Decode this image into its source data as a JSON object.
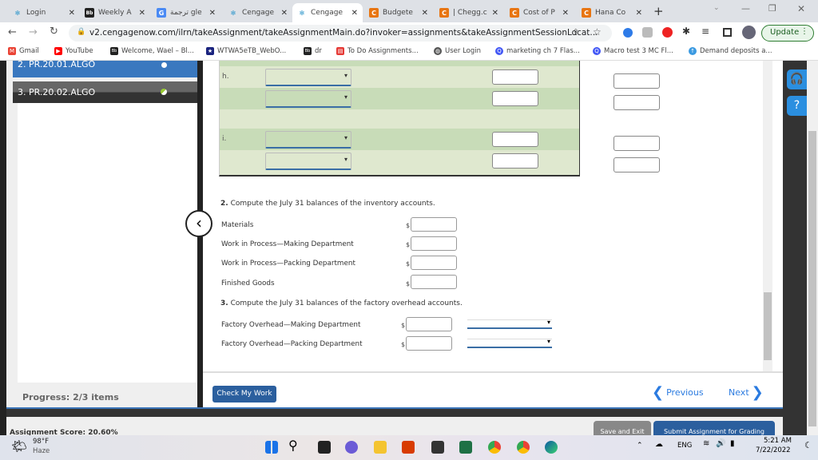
{
  "browser": {
    "tabs": [
      {
        "label": "Login",
        "icon": "cengage-spinner-icon"
      },
      {
        "label": "Weekly A",
        "icon": "blackboard-icon"
      },
      {
        "label": "ترجمة gle",
        "icon": "google-translate-icon"
      },
      {
        "label": "Cengage",
        "icon": "cengage-spinner-icon"
      },
      {
        "label": "Cengage",
        "icon": "cengage-spinner-icon",
        "active": true
      },
      {
        "label": "Budgete",
        "icon": "chegg-icon"
      },
      {
        "label": "| Chegg.c",
        "icon": "chegg-icon"
      },
      {
        "label": "Cost of P",
        "icon": "chegg-icon"
      },
      {
        "label": "Hana Co",
        "icon": "chegg-icon"
      }
    ],
    "url": "v2.cengagenow.com/ilrn/takeAssignment/takeAssignmentMain.do?invoker=assignments&takeAssignmentSessionLocat...",
    "update_label": "Update",
    "bookmarks": [
      "Gmail",
      "YouTube",
      "Welcome, Wael – Bl...",
      "WTWA5eTB_WebO...",
      "dr",
      "To Do Assignments...",
      "User Login",
      "marketing ch 7 Flas...",
      "Macro test 3 MC Fl...",
      "Demand deposits a..."
    ]
  },
  "sidebar": {
    "items": [
      {
        "label": "2. PR.20.01.ALGO"
      },
      {
        "label": "3. PR.20.02.ALGO"
      }
    ],
    "progress": "Progress: 2/3 items"
  },
  "table": {
    "rows": [
      {
        "label": "h."
      },
      {
        "label": ""
      },
      {
        "label": ""
      },
      {
        "label": "i."
      },
      {
        "label": ""
      }
    ]
  },
  "q2": {
    "title_num": "2.",
    "title": "Compute the July 31 balances of the inventory accounts.",
    "currency": "$",
    "items": [
      "Materials",
      "Work in Process—Making Department",
      "Work in Process—Packing Department",
      "Finished Goods"
    ]
  },
  "q3": {
    "title_num": "3.",
    "title": "Compute the July 31 balances of the factory overhead accounts.",
    "items": [
      "Factory Overhead—Making Department",
      "Factory Overhead—Packing Department"
    ]
  },
  "footer": {
    "check": "Check My Work",
    "previous": "Previous",
    "next": "Next"
  },
  "scorebar": {
    "score": "Assignment Score:   20.60%",
    "save": "Save and Exit",
    "submit": "Submit Assignment for Grading"
  },
  "taskbar": {
    "temp": "98°F",
    "weather": "Haze",
    "lang": "ENG",
    "time": "5:21 AM",
    "date": "7/22/2022"
  },
  "colors": {
    "accent": "#2b5f9e",
    "sidebar_active": "#3a78bf",
    "table_light": "#dfe8cf",
    "table_dark": "#c8dcb8"
  }
}
